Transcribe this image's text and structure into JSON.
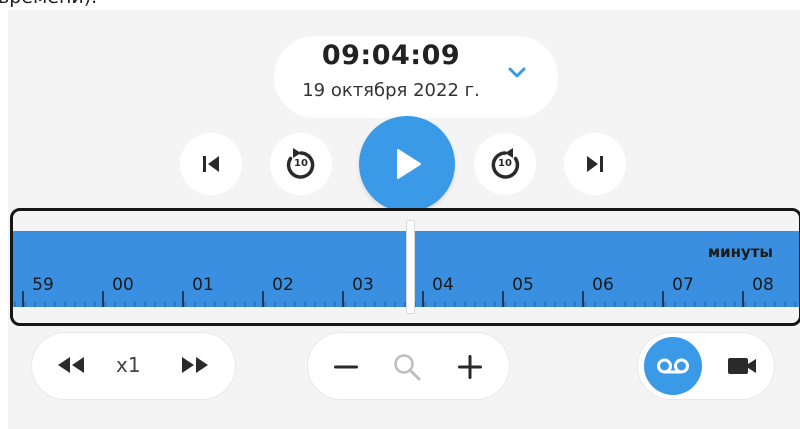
{
  "top_text": "времени).",
  "header": {
    "time": "09:04:09",
    "date": "19 октября 2022 г."
  },
  "icons": {
    "expand": "chevron-down-icon",
    "prev": "skip-previous-icon",
    "rewind10": "replay-10-icon",
    "play": "play-icon",
    "forward10": "forward-10-icon",
    "next": "skip-next-icon",
    "slower": "fast-rewind-icon",
    "faster": "fast-forward-icon",
    "zoom_out": "minus-icon",
    "zoom": "search-icon",
    "zoom_in": "plus-icon",
    "archive": "voicemail-icon",
    "live": "videocam-icon"
  },
  "controls": {
    "rewind_number": "10",
    "forward_number": "10"
  },
  "timeline": {
    "unit_label": "минуты",
    "tick_labels": [
      "59",
      "00",
      "01",
      "02",
      "03",
      "04",
      "05",
      "06",
      "07",
      "08"
    ]
  },
  "speed": {
    "label": "x1"
  },
  "colors": {
    "accent": "#3a9ae8",
    "band": "#3a8fe0",
    "background": "#f4f4f4",
    "text": "#1b1b1b"
  }
}
